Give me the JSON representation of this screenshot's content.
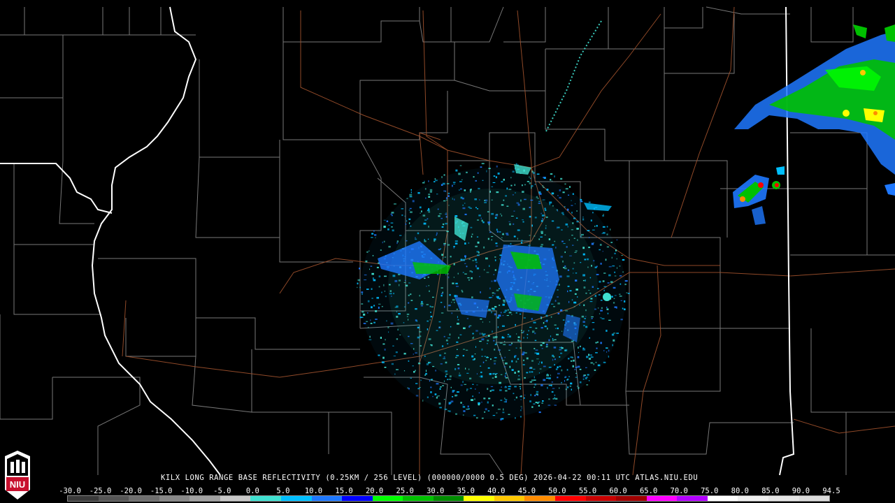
{
  "product": {
    "caption": "KILX LONG RANGE BASE REFLECTIVITY (0.25KM / 256 LEVEL) (000000/0000 0.5 DEG) 2026-04-22 00:11 UTC  ATLAS.NIU.EDU"
  },
  "logo": {
    "text": "NIU",
    "color": "#c8102e"
  },
  "scale": {
    "labels": [
      "-30.0",
      "-25.0",
      "-20.0",
      "-15.0",
      "-10.0",
      "-5.0",
      "0.0",
      "5.0",
      "10.0",
      "15.0",
      "20.0",
      "25.0",
      "30.0",
      "35.0",
      "40.0",
      "45.0",
      "50.0",
      "55.0",
      "60.0",
      "65.0",
      "70.0",
      "75.0",
      "80.0",
      "85.0",
      "90.0",
      "94.5"
    ],
    "colors": [
      "#3a3a3a",
      "#555555",
      "#6e6e6e",
      "#888888",
      "#a2a2a2",
      "#c8c8c8",
      "#40e0d0",
      "#00bfff",
      "#1e78ff",
      "#0000ff",
      "#00ff00",
      "#00c000",
      "#008c00",
      "#ffff00",
      "#ffc800",
      "#ff8c00",
      "#ff0000",
      "#c80000",
      "#a00000",
      "#ff00ff",
      "#b400ff",
      "#ffffff",
      "#f0f0f0",
      "#e6e6e6",
      "#dcdcdc"
    ]
  },
  "colors": {
    "county_lines": "#8c8c8c",
    "state_lines": "#ffffff",
    "roads": "#a0522d"
  }
}
